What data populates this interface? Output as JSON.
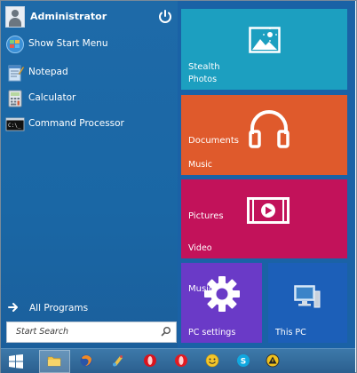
{
  "user": {
    "name": "Administrator"
  },
  "menu": {
    "items": [
      {
        "label": "Show Start Menu",
        "icon": "globe-icon"
      },
      {
        "label": "Notepad",
        "icon": "notepad-icon"
      },
      {
        "label": "Calculator",
        "icon": "calculator-icon"
      },
      {
        "label": "Command Processor",
        "icon": "command-prompt-icon"
      }
    ],
    "all_programs": "All Programs",
    "search_placeholder": "Start Search"
  },
  "tiles": {
    "photos": {
      "subtitle": "Stealth",
      "label": "Photos",
      "color": "#1c9fc0"
    },
    "music": {
      "subtitle": "Documents",
      "label": "Music",
      "color": "#df5a2c"
    },
    "video": {
      "subtitle": "Pictures",
      "label": "Video",
      "color": "#c2125a"
    },
    "pc_settings": {
      "subtitle": "Music",
      "label": "PC settings",
      "color": "#6a3ac7"
    },
    "this_pc": {
      "label": "This PC",
      "color": "#1c5fb8"
    }
  },
  "taskbar": {
    "items": [
      "start-button",
      "file-explorer-icon",
      "firefox-icon",
      "paint-icon",
      "opera-icon",
      "opera-icon",
      "messenger-icon",
      "skype-icon",
      "warning-icon"
    ]
  }
}
